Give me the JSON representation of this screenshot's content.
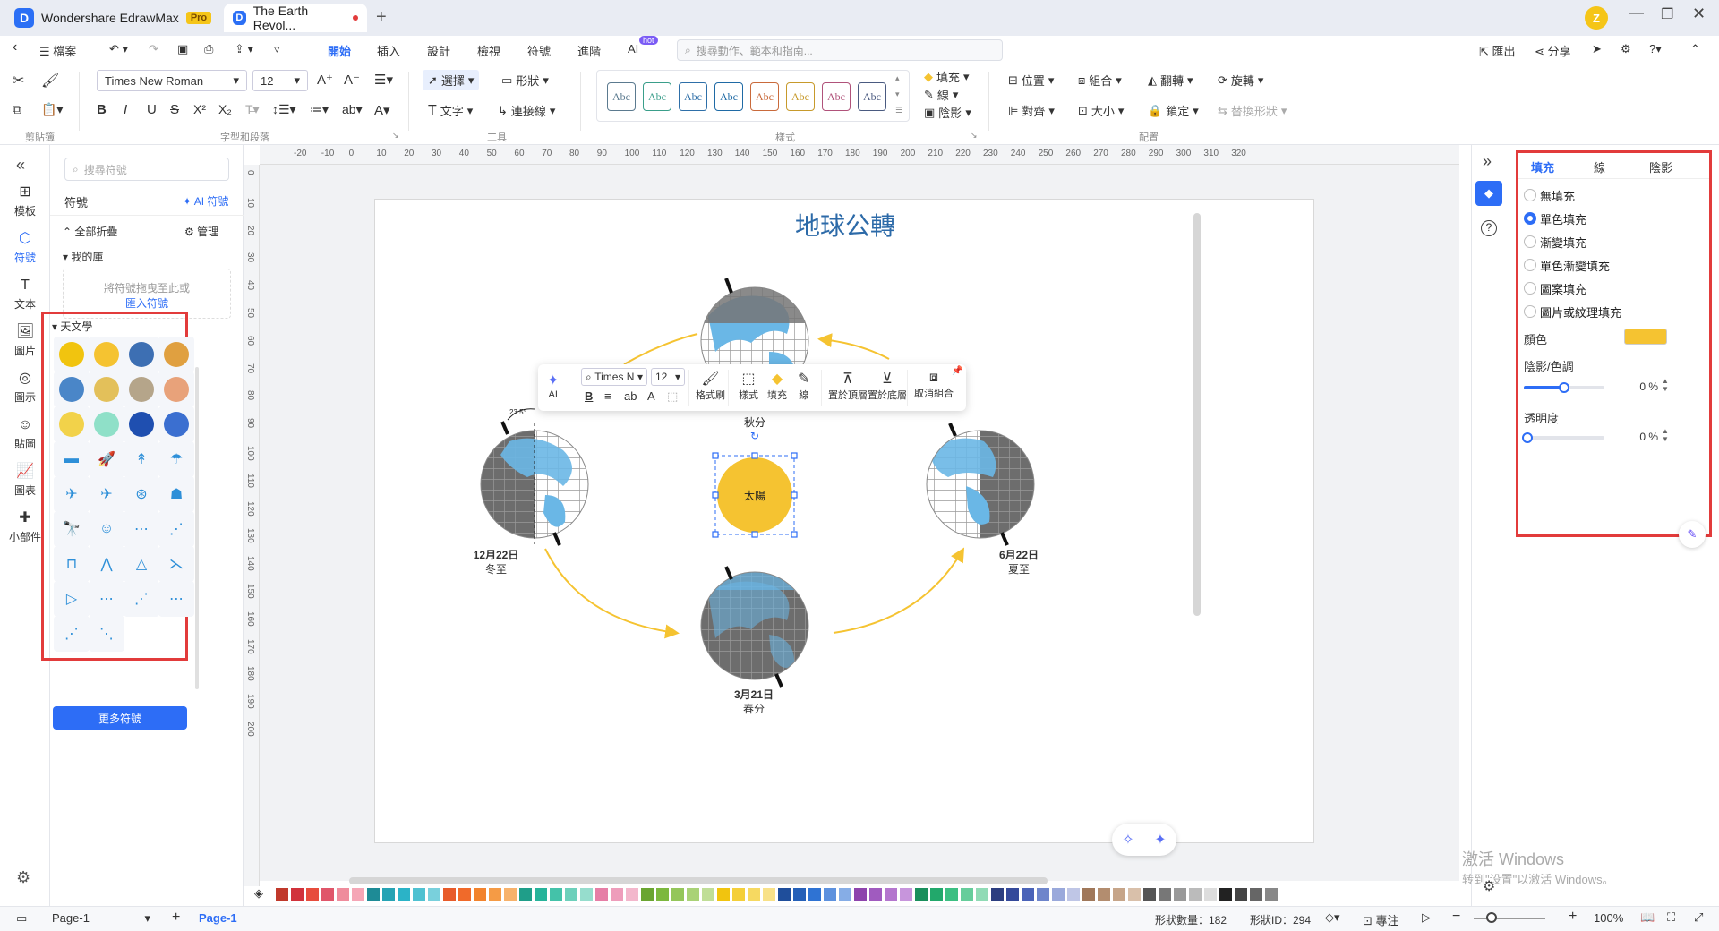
{
  "titlebar": {
    "app_tab": "Wondershare EdrawMax",
    "pro_badge": "Pro",
    "doc_tab": "The Earth Revol...",
    "user_initial": "Z"
  },
  "menu": {
    "file": "檔案",
    "items": [
      "開始",
      "插入",
      "設計",
      "檢視",
      "符號",
      "進階",
      "AI"
    ],
    "hot_badge": "hot",
    "search_placeholder": "搜尋動作、範本和指南...",
    "export": "匯出",
    "share": "分享"
  },
  "ribbon": {
    "font_family": "Times New Roman",
    "font_size": "12",
    "select": "選擇",
    "shape": "形狀",
    "text": "文字",
    "connector": "連接線",
    "fill": "填充",
    "line": "線",
    "shadow": "陰影",
    "position": "位置",
    "group": "組合",
    "flip": "翻轉",
    "rotate": "旋轉",
    "align": "對齊",
    "size": "大小",
    "lock": "鎖定",
    "replace_shape": "替換形狀",
    "style_sample": "Abc",
    "style_colors": [
      "#5b7a8f",
      "#3a9e8a",
      "#2e6fa8",
      "#1f6aa5",
      "#c96a3b",
      "#c79a2b",
      "#b0527a",
      "#4a5a80"
    ],
    "groups": [
      "剪貼簿",
      "字型和段落",
      "工具",
      "樣式",
      "配置"
    ]
  },
  "leftnav": [
    {
      "icon": "template-icon",
      "label": "模板"
    },
    {
      "icon": "symbol-icon",
      "label": "符號"
    },
    {
      "icon": "text-icon",
      "label": "文本"
    },
    {
      "icon": "image-icon",
      "label": "圖片"
    },
    {
      "icon": "icon-icon",
      "label": "圖示"
    },
    {
      "icon": "sticker-icon",
      "label": "貼圖"
    },
    {
      "icon": "chart-icon",
      "label": "圖表"
    },
    {
      "icon": "widget-icon",
      "label": "小部件"
    }
  ],
  "symbols": {
    "search_placeholder": "搜尋符號",
    "title": "符號",
    "ai_symbol": "AI 符號",
    "collapse_all": "全部折疊",
    "manage": "管理",
    "my_library": "我的庫",
    "drop_hint": "將符號拖曳至此或",
    "import": "匯入符號",
    "astronomy": "天文學",
    "more": "更多符號"
  },
  "diagram": {
    "title": "地球公轉",
    "sun": "太陽",
    "autumn_date": "",
    "autumn": "秋分",
    "winter_date": "12月22日",
    "winter": "冬至",
    "summer_date": "6月22日",
    "summer": "夏至",
    "spring_date": "3月21日",
    "spring": "春分",
    "tilt": "23.5°"
  },
  "floatbar": {
    "ai": "AI",
    "font": "Times N",
    "size": "12",
    "format_painter": "格式刷",
    "style": "樣式",
    "fill": "填充",
    "line": "線",
    "to_front": "置於頂層",
    "to_back": "置於底層",
    "ungroup": "取消組合"
  },
  "fillpanel": {
    "tabs": [
      "填充",
      "線",
      "陰影"
    ],
    "options": [
      "無填充",
      "單色填充",
      "漸變填充",
      "單色漸變填充",
      "圖案填充",
      "圖片或紋理填充"
    ],
    "selected_index": 1,
    "color_label": "顏色",
    "color_value": "#f5c331",
    "shade_label": "陰影/色調",
    "shade_value": "0 %",
    "transparency_label": "透明度",
    "transparency_value": "0 %"
  },
  "status": {
    "page_tab": "Page-1",
    "active_page": "Page-1",
    "shape_count": "形狀數量：182",
    "shape_id": "形狀ID：294",
    "focus": "專注",
    "zoom": "100%"
  },
  "watermark": {
    "line1": "激活 Windows",
    "line2": "转到\"设置\"以激活 Windows。"
  },
  "palette": [
    "#c0392b",
    "#d1323b",
    "#e74c3c",
    "#e0566a",
    "#ef8c9c",
    "#f5a6b6",
    "#1e8b96",
    "#26a3b4",
    "#2bb3c7",
    "#4fc1d1",
    "#79d0dc",
    "#e85b2a",
    "#f06a2a",
    "#f2832d",
    "#f59b45",
    "#f7b26b",
    "#1f9e89",
    "#27b39a",
    "#44c2a9",
    "#6dd0bb",
    "#96ddcd",
    "#e67ea6",
    "#ee9dbb",
    "#f3b7cc",
    "#6aa531",
    "#7cb83e",
    "#94c65a",
    "#a9d276",
    "#c0de97",
    "#f1c40f",
    "#f4cf3a",
    "#f6d961",
    "#f8e188",
    "#1f4e9b",
    "#2560b8",
    "#2f73d3",
    "#5d91de",
    "#86ade6",
    "#8e44ad",
    "#a05bbf",
    "#b476ce",
    "#c795dc",
    "#1a8f5c",
    "#22a86b",
    "#3cbf82",
    "#66cd9b",
    "#90dbb5",
    "#2c3e80",
    "#34499a",
    "#4a63b8",
    "#6e85cb",
    "#9aa9db",
    "#bfc6e6",
    "#a0785a",
    "#b38d6f",
    "#c6a589",
    "#d9c0aa",
    "#555",
    "#777",
    "#999",
    "#bbb",
    "#ddd",
    "#222",
    "#444",
    "#666",
    "#888"
  ]
}
